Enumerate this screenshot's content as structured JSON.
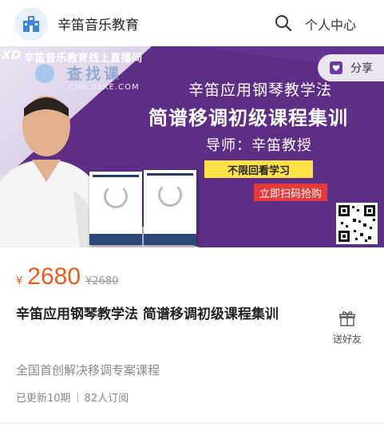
{
  "header": {
    "site_name": "辛笛音乐教育",
    "user_center_label": "个人中心",
    "logo_icon": "school-house-icon",
    "search_icon": "search-icon"
  },
  "banner": {
    "brand_mark": "XD",
    "live_caption": "辛笛音乐教育线上直播间",
    "watermark_text": "查找课",
    "watermark_url": "CHA.98KE.COM",
    "share_label": "分享",
    "course_subtitle": "辛笛应用钢琴教学法",
    "course_title": "简谱移调初级课程集训",
    "teacher": "导师：辛笛教授",
    "replay_tag": "不限回看学习",
    "scan_tag": "立即扫码抢购",
    "colors": {
      "background": "#5a2d82",
      "highlight": "#ffe24a",
      "scan_tag": "#e33b3b"
    }
  },
  "product": {
    "price_symbol": "¥",
    "price": "2680",
    "original_price": "¥2680",
    "title": "辛笛应用钢琴教学法 简谱移调初级课程集训",
    "gift_label": "送好友",
    "subtitle": "全国首创解决移调专案课程",
    "updated": "已更新10期",
    "subscribers": "82人订阅",
    "colors": {
      "price": "#f05a1a"
    }
  }
}
